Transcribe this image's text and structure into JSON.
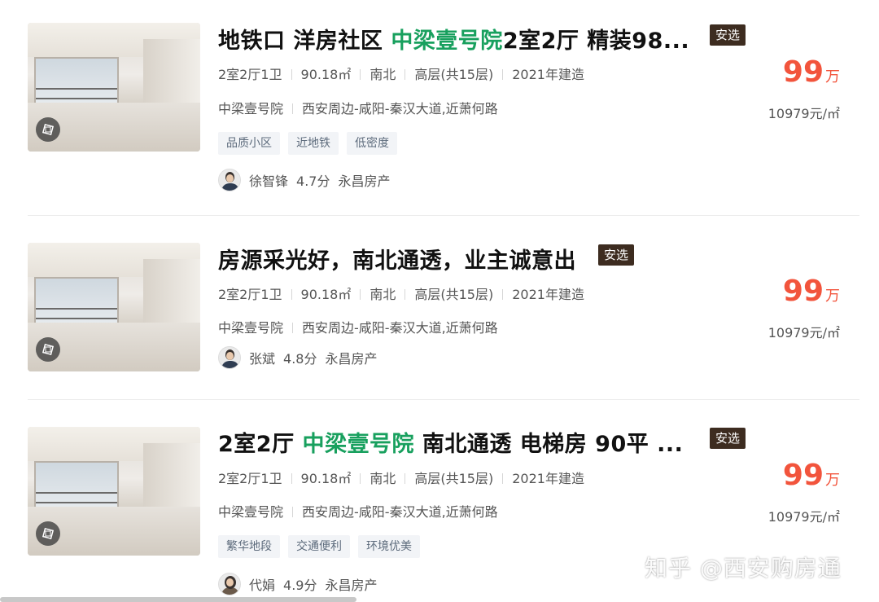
{
  "listings": [
    {
      "title_parts": [
        "地铁口 洋房社区 ",
        "中梁壹号院",
        "2室2厅 精装98..."
      ],
      "badge": "安选",
      "info": [
        "2室2厅1卫",
        "90.18㎡",
        "南北",
        "高层(共15层)",
        "2021年建造"
      ],
      "community": "中梁壹号院",
      "address": "西安周边-咸阳-秦汉大道,近萧何路",
      "tags": [
        "品质小区",
        "近地铁",
        "低密度"
      ],
      "agent": {
        "name": "徐智锋",
        "score": "4.7分",
        "company": "永昌房产"
      },
      "price": {
        "num": "99",
        "unit": "万"
      },
      "unit_price": "10979元/㎡"
    },
    {
      "title_parts": [
        "房源采光好，南北通透，业主诚意出",
        "",
        ""
      ],
      "badge": "安选",
      "info": [
        "2室2厅1卫",
        "90.18㎡",
        "南北",
        "高层(共15层)",
        "2021年建造"
      ],
      "community": "中梁壹号院",
      "address": "西安周边-咸阳-秦汉大道,近萧何路",
      "tags": [],
      "agent": {
        "name": "张斌",
        "score": "4.8分",
        "company": "永昌房产"
      },
      "price": {
        "num": "99",
        "unit": "万"
      },
      "unit_price": "10979元/㎡"
    },
    {
      "title_parts": [
        "2室2厅 ",
        "中梁壹号院",
        " 南北通透 电梯房 90平 ..."
      ],
      "badge": "安选",
      "info": [
        "2室2厅1卫",
        "90.18㎡",
        "南北",
        "高层(共15层)",
        "2021年建造"
      ],
      "community": "中梁壹号院",
      "address": "西安周边-咸阳-秦汉大道,近萧何路",
      "tags": [
        "繁华地段",
        "交通便利",
        "环境优美"
      ],
      "agent": {
        "name": "代娟",
        "score": "4.9分",
        "company": "永昌房产"
      },
      "price": {
        "num": "99",
        "unit": "万"
      },
      "unit_price": "10979元/㎡"
    }
  ],
  "watermark": "知乎 @西安购房通",
  "colors": {
    "highlight": "#18a05e",
    "price": "#f2543c",
    "badge_bg": "#3d2c20"
  },
  "icons": {
    "thumb_overlay": "vr-360-icon"
  }
}
